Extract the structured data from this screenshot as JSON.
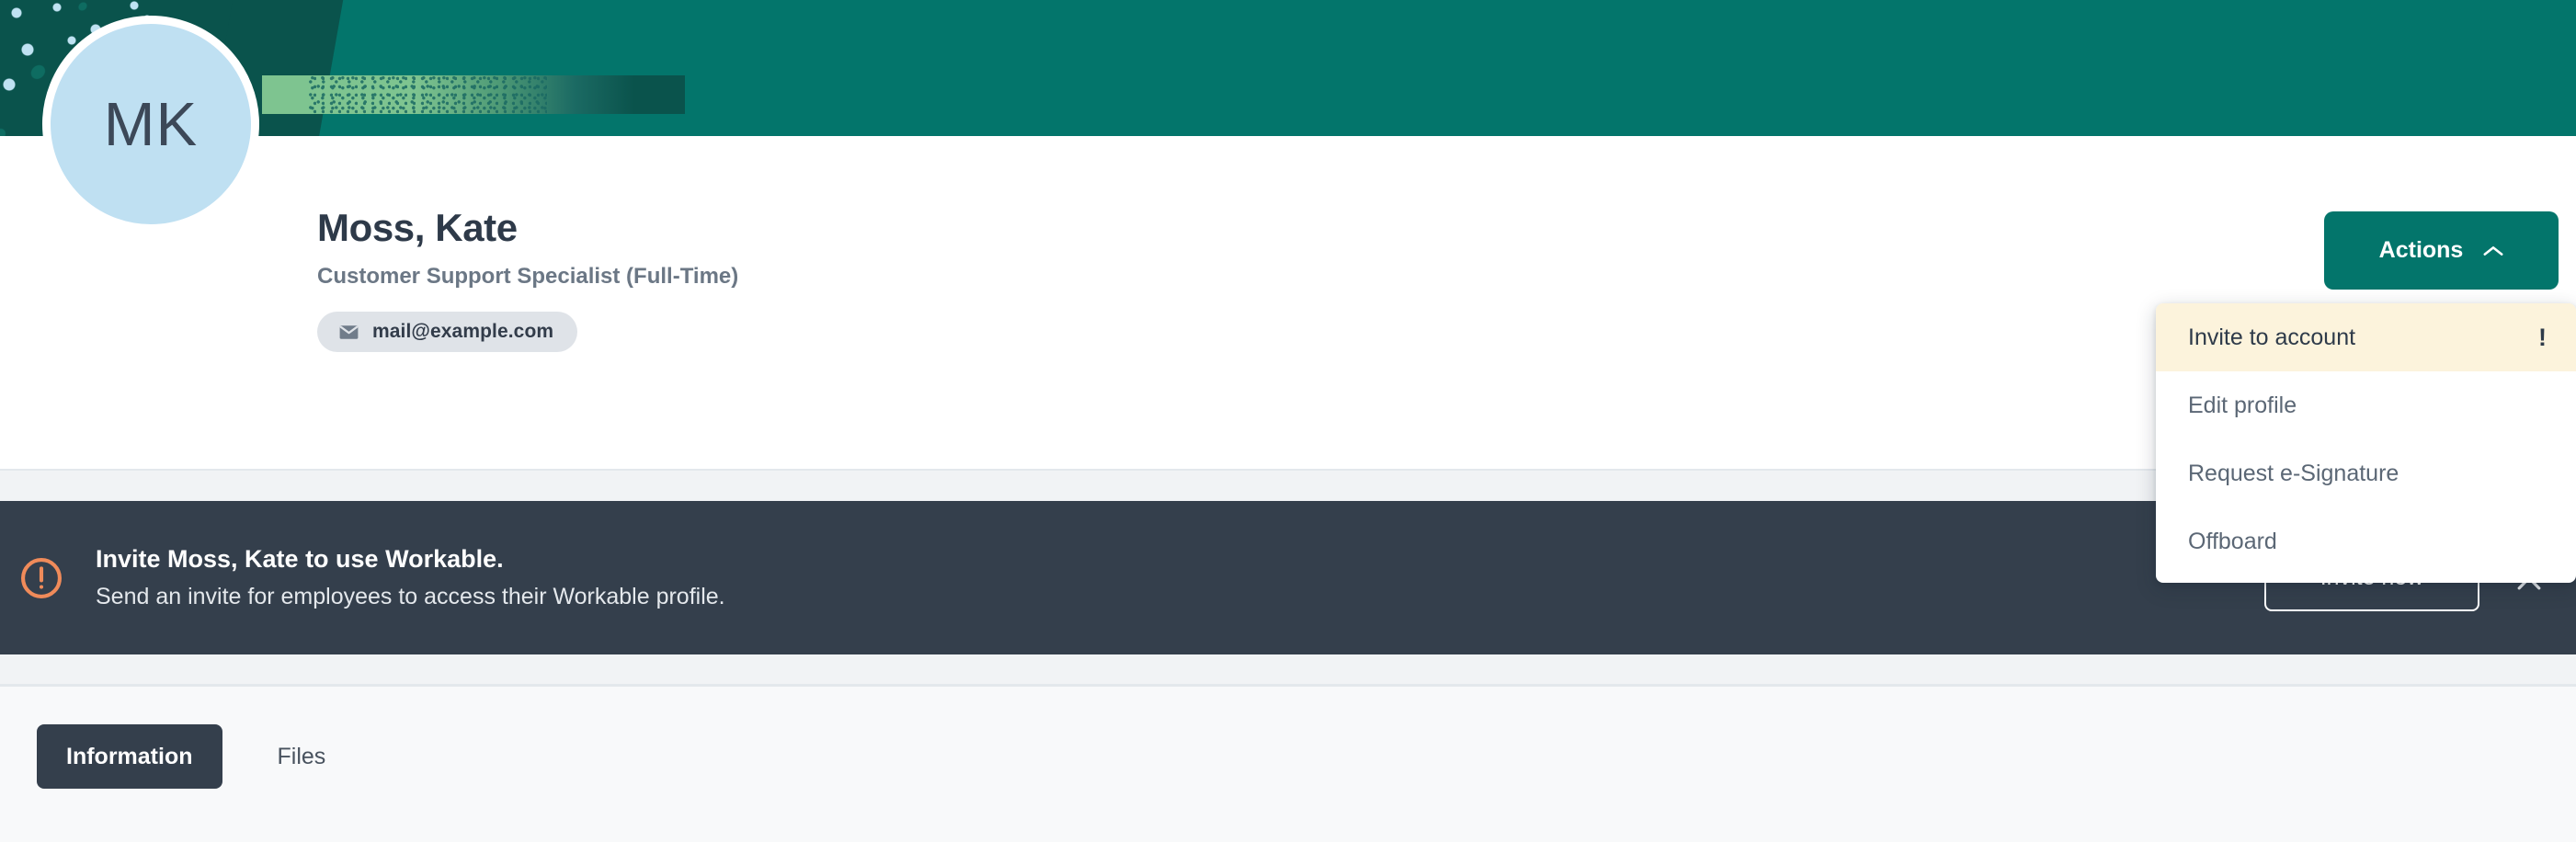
{
  "header": {
    "banner_color": "#03756b",
    "accent_dark": "#0a534c",
    "accent_light_green": "#7ec490"
  },
  "avatar": {
    "initials": "MK",
    "background_color": "#bfe0f2"
  },
  "profile": {
    "name": "Moss, Kate",
    "role": "Customer Support Specialist (Full-Time)",
    "email": "mail@example.com",
    "mail_icon": "mail-icon"
  },
  "actions": {
    "button_label": "Actions",
    "chevron_icon": "chevron-up-icon",
    "expanded": true,
    "menu_items": [
      {
        "label": "Invite to account",
        "highlighted": true,
        "badge": "!"
      },
      {
        "label": "Edit profile",
        "highlighted": false,
        "badge": ""
      },
      {
        "label": "Request e-Signature",
        "highlighted": false,
        "badge": ""
      },
      {
        "label": "Offboard",
        "highlighted": false,
        "badge": ""
      }
    ]
  },
  "invite_banner": {
    "alert_icon": "alert-circle-icon",
    "alert_color": "#f08b5a",
    "title": "Invite Moss, Kate to use Workable.",
    "subtitle": "Send an invite for employees to access their Workable profile.",
    "action_label": "Invite now",
    "close_icon": "close-icon",
    "background_color": "#343f4c"
  },
  "tabs": {
    "items": [
      {
        "label": "Information",
        "active": true
      },
      {
        "label": "Files",
        "active": false
      }
    ]
  }
}
